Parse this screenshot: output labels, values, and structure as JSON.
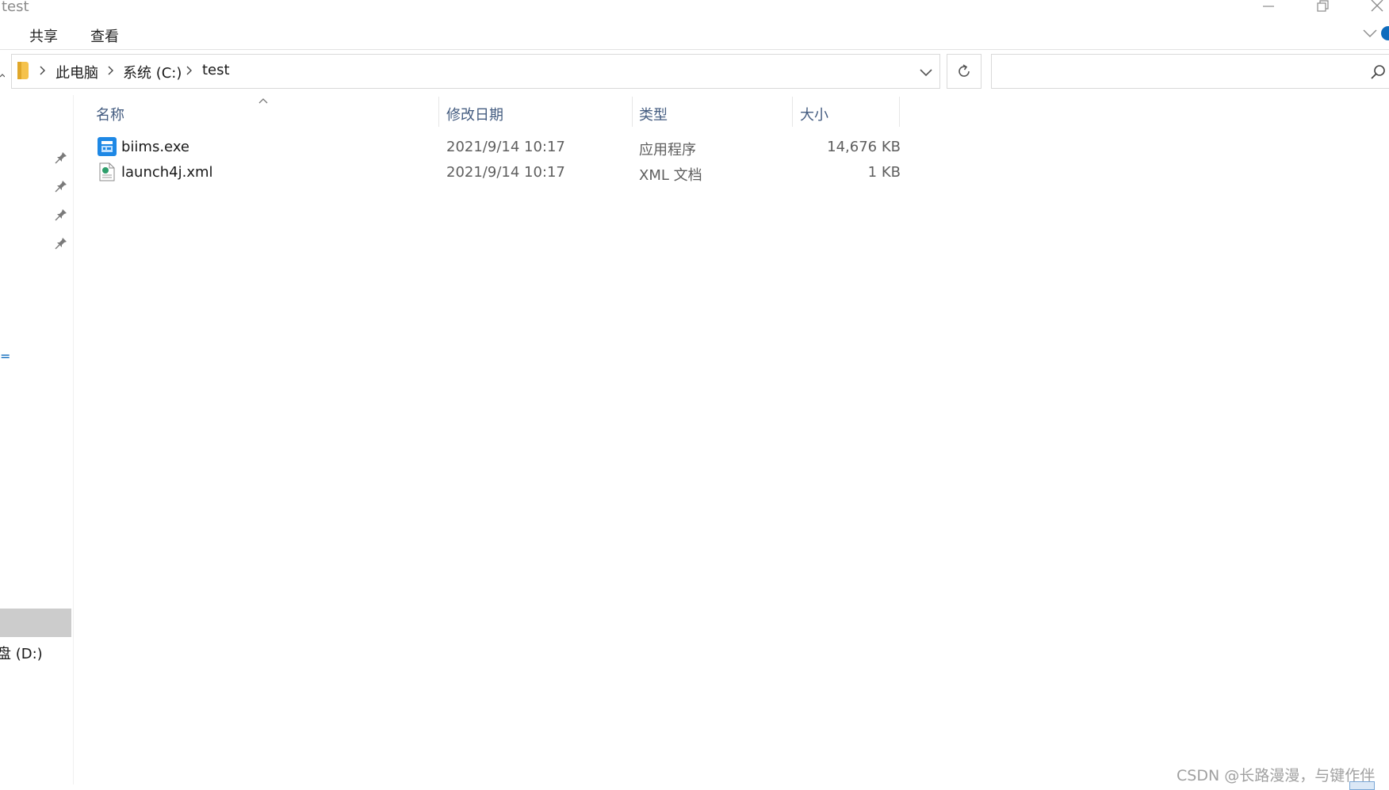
{
  "window": {
    "title": "test"
  },
  "ribbon": {
    "tabs": [
      {
        "label": "共享"
      },
      {
        "label": "查看"
      }
    ]
  },
  "address": {
    "breadcrumb": [
      {
        "label": "此电脑"
      },
      {
        "label": "系统 (C:)"
      },
      {
        "label": "test"
      }
    ]
  },
  "search": {
    "placeholder": ""
  },
  "nav": {
    "selected_label": ")",
    "items": [
      {
        "label": "盘 (D:)"
      }
    ],
    "mark": "="
  },
  "columns": {
    "name": "名称",
    "modified": "修改日期",
    "type": "类型",
    "size": "大小"
  },
  "files": [
    {
      "name": "biims.exe",
      "modified": "2021/9/14 10:17",
      "type": "应用程序",
      "size": "14,676 KB",
      "icon": "exe-icon"
    },
    {
      "name": "launch4j.xml",
      "modified": "2021/9/14 10:17",
      "type": "XML 文档",
      "size": "1 KB",
      "icon": "xml-document-icon"
    }
  ],
  "watermark": "CSDN @长路漫漫，与键作伴",
  "colors": {
    "accent": "#0f6cbd",
    "header_text": "#445c80",
    "selection": "#cccccc",
    "folder": "#f5c24c"
  }
}
